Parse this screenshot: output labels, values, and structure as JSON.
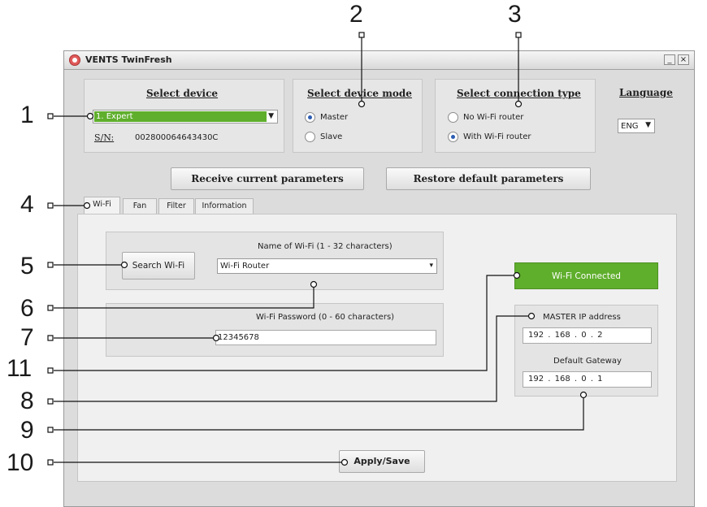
{
  "callouts": [
    "1",
    "2",
    "3",
    "4",
    "5",
    "6",
    "7",
    "11",
    "8",
    "9",
    "10"
  ],
  "window": {
    "title": "VENTS TwinFresh",
    "minimize": "_",
    "close": "×"
  },
  "select_device": {
    "title": "Select device",
    "device": "1. Expert",
    "sn_label": "S/N:",
    "sn_value": "002800064643430C"
  },
  "device_mode": {
    "title": "Select device mode",
    "options": [
      "Master",
      "Slave"
    ],
    "selected": "Master"
  },
  "connection_type": {
    "title": "Select connection type",
    "options": [
      "No Wi-Fi router",
      "With Wi-Fi router"
    ],
    "selected": "With Wi-Fi router"
  },
  "language": {
    "title": "Language",
    "value": "ENG"
  },
  "buttons": {
    "receive": "Receive current parameters",
    "restore": "Restore default parameters",
    "apply": "Apply/Save"
  },
  "tabs": [
    {
      "label": "Wi-Fi",
      "active": true
    },
    {
      "label": "Fan",
      "active": false
    },
    {
      "label": "Filter",
      "active": false
    },
    {
      "label": "Information",
      "active": false
    }
  ],
  "wifi": {
    "search_button": "Search Wi-Fi",
    "name_label": "Name of Wi-Fi (1 - 32 characters)",
    "name_value": "Wi-Fi Router",
    "password_label": "Wi-Fi Password (0 - 60 characters)",
    "password_value": "12345678",
    "status": "Wi-Fi Connected"
  },
  "network": {
    "master_ip_label": "MASTER IP address",
    "master_ip": "192 . 168 . 0 . 2",
    "gateway_label": "Default Gateway",
    "gateway": "192 . 168 . 0 . 1"
  },
  "colors": {
    "green_status": "#5fae2c",
    "selected_device": "#5fae2c",
    "radio_dot": "#2d5db3"
  },
  "icons": {
    "app": "fan-logo-icon",
    "dropdown": "chevron-down-icon"
  }
}
